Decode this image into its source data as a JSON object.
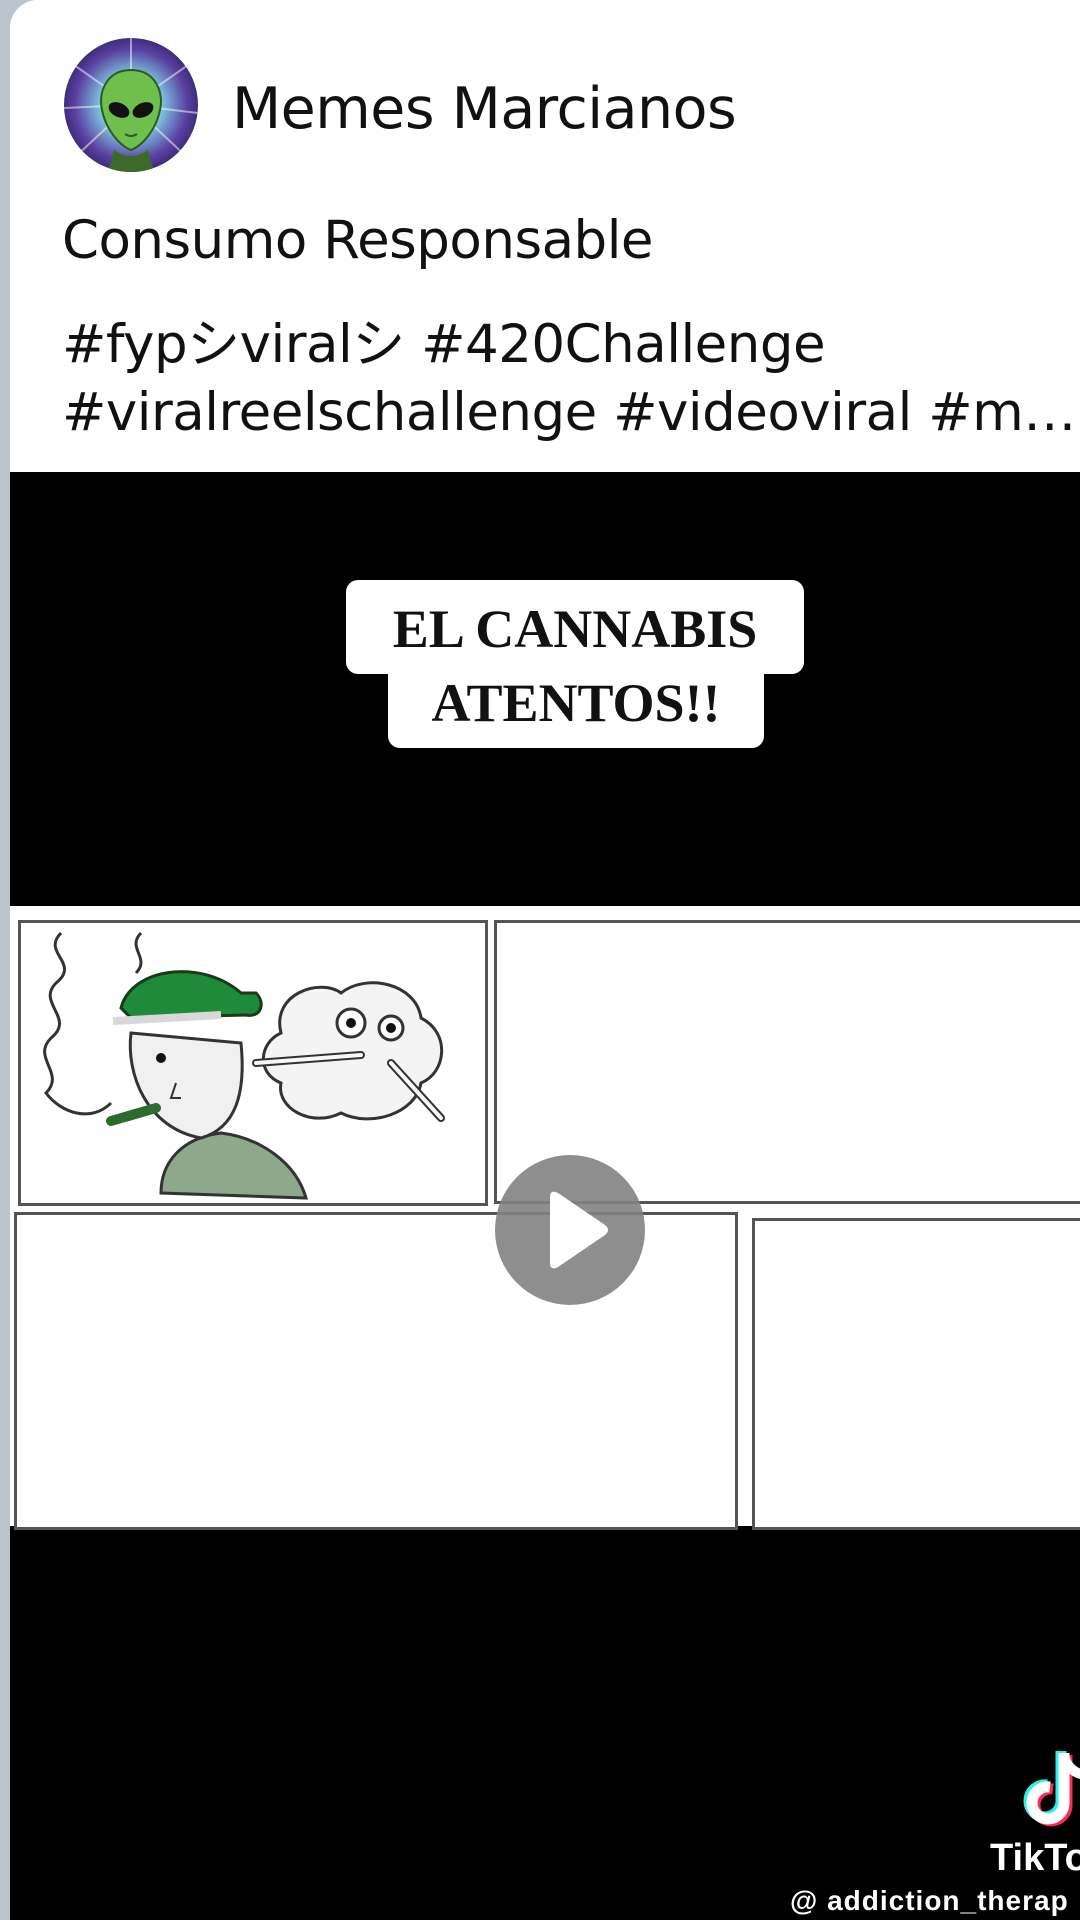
{
  "post": {
    "page_name": "Memes Marcianos",
    "avatar_icon": "alien-avatar-icon",
    "caption_line1": "Consumo Responsable",
    "caption_line2": "#fypシviralシ #420Challenge",
    "caption_line3": "#viralreelschallenge #videoviral #me..."
  },
  "video": {
    "title_line1": "EL CANNABIS",
    "title_line2": "ATENTOS!!",
    "play_icon": "play-icon",
    "watermark_logo": "tiktok-logo-icon",
    "watermark_label": "TikTo",
    "watermark_handle": "@ addiction_therap"
  },
  "colors": {
    "background": "#b9c4cc",
    "card": "#ffffff",
    "video_bg": "#000000",
    "play_button": "#828282",
    "cap_green": "#1f8a3a"
  }
}
